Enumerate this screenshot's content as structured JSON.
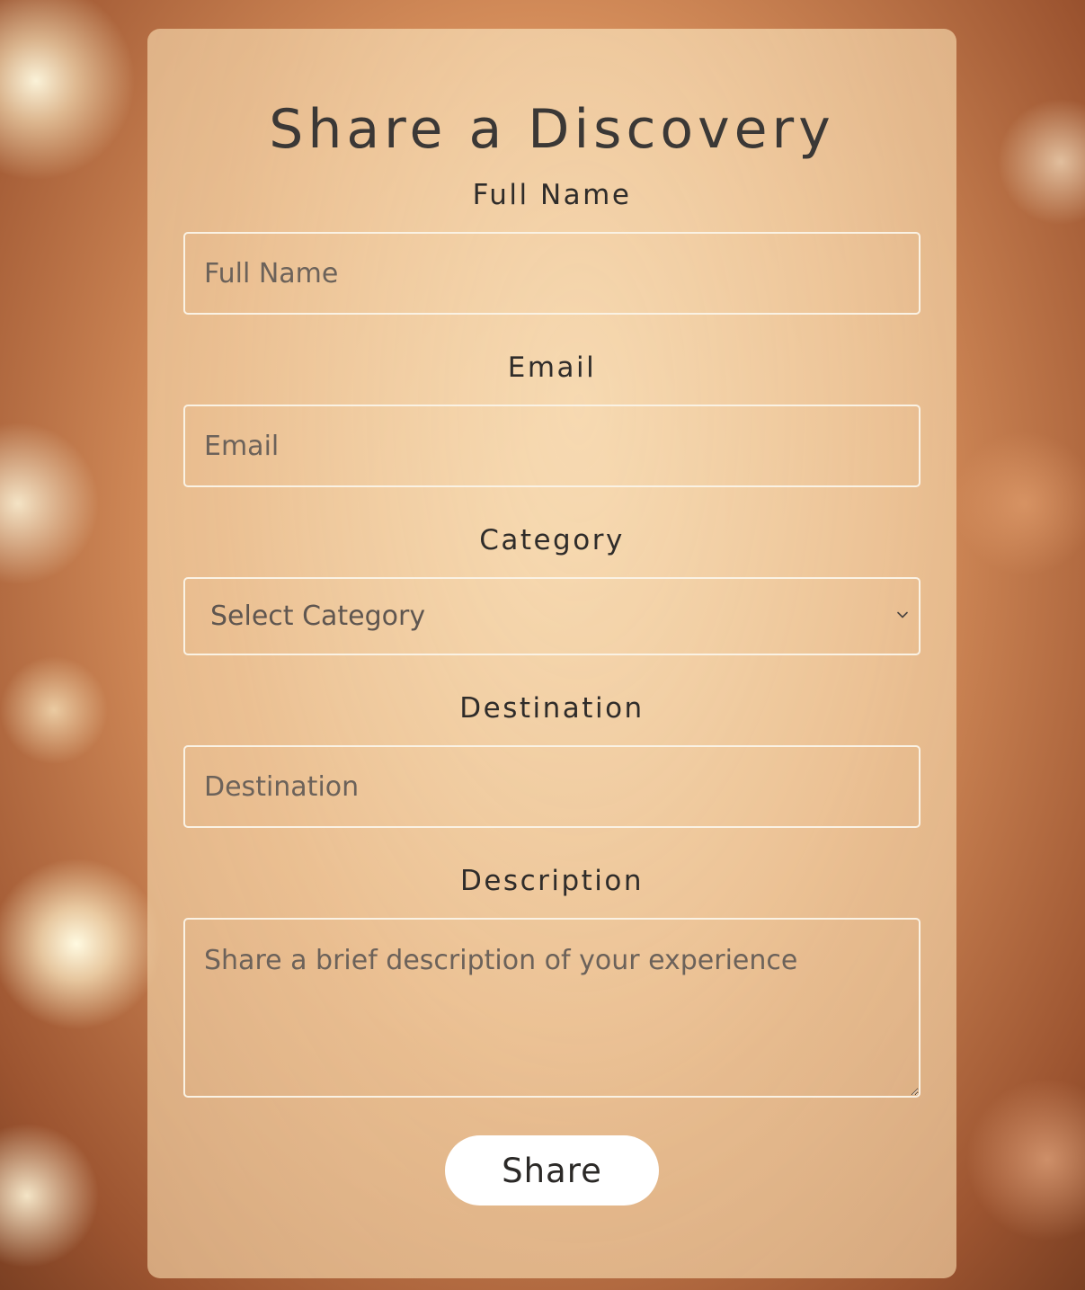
{
  "form": {
    "title": "Share a Discovery",
    "fields": {
      "full_name": {
        "label": "Full Name",
        "placeholder": "Full Name",
        "value": ""
      },
      "email": {
        "label": "Email",
        "placeholder": "Email",
        "value": ""
      },
      "category": {
        "label": "Category",
        "selected": "Select Category"
      },
      "destination": {
        "label": "Destination",
        "placeholder": "Destination",
        "value": ""
      },
      "description": {
        "label": "Description",
        "placeholder": "Share a brief description of your experience",
        "value": ""
      }
    },
    "submit_label": "Share"
  },
  "icons": {
    "select_arrow": "chevron-down-icon"
  },
  "colors": {
    "title_text": "#3b3836",
    "field_border": "#faf2e4",
    "button_bg": "#ffffff",
    "card_tint": "#ecc89b"
  }
}
